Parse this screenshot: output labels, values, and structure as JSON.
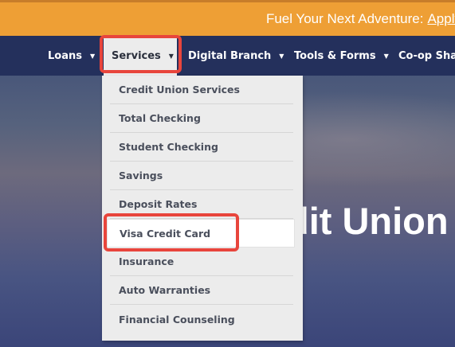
{
  "promo": {
    "text": "Fuel Your Next Adventure:",
    "link": "Apply"
  },
  "nav": {
    "items": [
      {
        "label": "Loans",
        "caret": "▼"
      },
      {
        "label": "Services",
        "caret": "▼"
      },
      {
        "label": "Digital Branch",
        "caret": "▼"
      },
      {
        "label": "Tools & Forms",
        "caret": "▼"
      },
      {
        "label": "Co-op Shar"
      }
    ]
  },
  "hero": {
    "title": "dit Union"
  },
  "dropdown": {
    "items": [
      "Credit Union Services",
      "Total Checking",
      "Student Checking",
      "Savings",
      "Deposit Rates",
      "Visa Credit Card",
      "Insurance",
      "Auto Warranties",
      "Financial Counseling"
    ]
  },
  "colors": {
    "promo_bg": "#ee9f35",
    "nav_bg": "#24305c",
    "dropdown_bg": "#ececec",
    "highlight": "#e8453c"
  }
}
